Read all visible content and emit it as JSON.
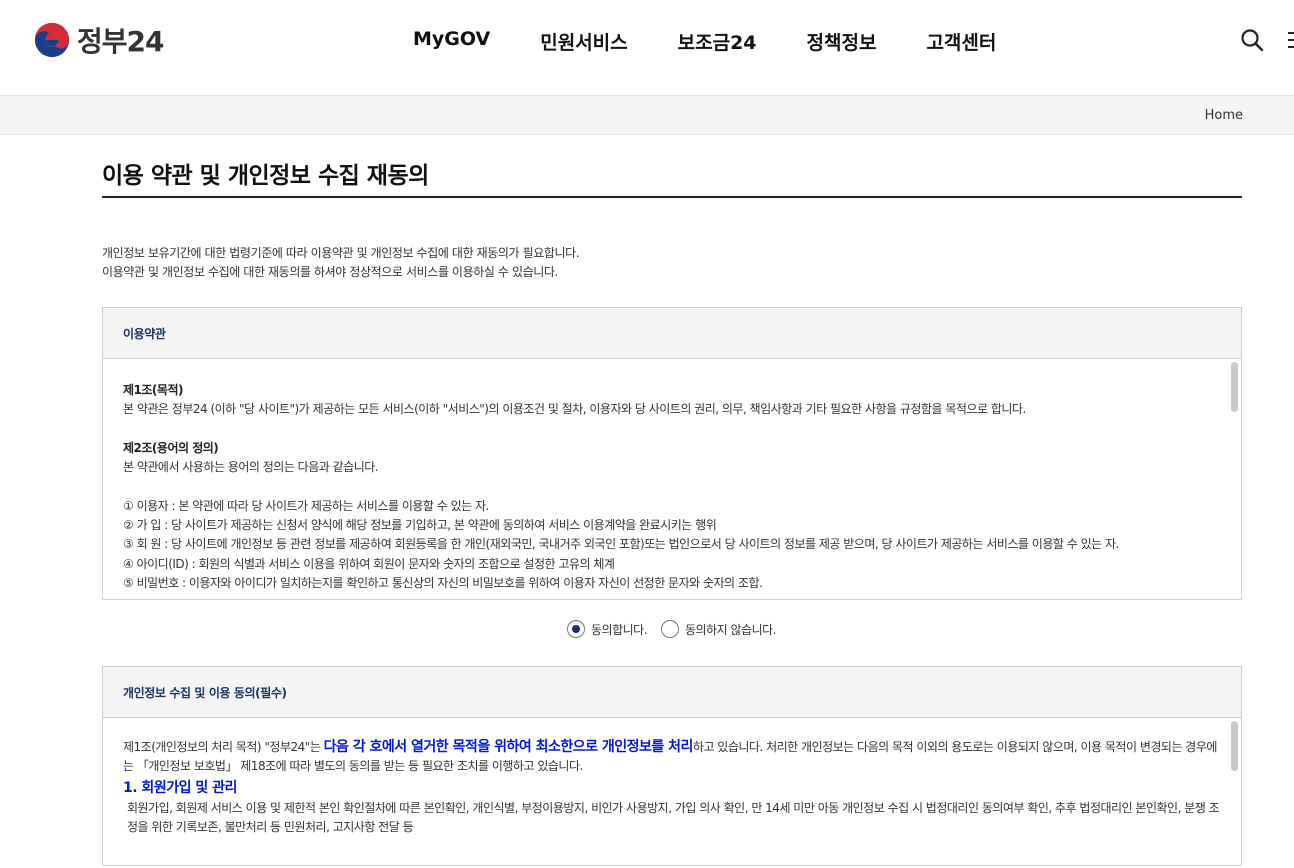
{
  "header": {
    "logo_text": "정부24",
    "nav": [
      "MyGOV",
      "민원서비스",
      "보조금24",
      "정책정보",
      "고객센터"
    ],
    "icons": [
      "search-icon",
      "menu-icon"
    ]
  },
  "breadcrumb": {
    "home": "Home"
  },
  "page": {
    "title": "이용 약관 및 개인정보 수집 재동의",
    "intro": [
      "개인정보 보유기간에 대한 법령기준에 따라 이용약관 및 개인정보 수집에 대한 재동의가 필요합니다.",
      "이용약관 및 개인정보 수집에 대한 재동의를 하셔야 정상적으로 서비스를 이용하실 수 있습니다."
    ]
  },
  "terms": {
    "heading": "이용약관",
    "art1_title": "제1조(목적)",
    "art1_text": "본 약관은 정부24 (이하 \"당 사이트\")가 제공하는 모든 서비스(이하 \"서비스\")의 이용조건 및 절차, 이용자와 당 사이트의 권리, 의무, 책임사항과 기타 필요한 사항을 규정함을 목적으로 합니다.",
    "art2_title": "제2조(용어의 정의)",
    "art2_text": "본 약관에서 사용하는 용어의 정의는 다음과 같습니다.",
    "items": [
      "① 이용자 : 본 약관에 따라 당 사이트가 제공하는 서비스를 이용할 수 있는 자.",
      "② 가 입 : 당 사이트가 제공하는 신청서 양식에 해당 정보를 기입하고, 본 약관에 동의하여 서비스 이용계약을 완료시키는 행위",
      "③ 회 원 : 당 사이트에 개인정보 등 관련 정보를 제공하여 회원등록을 한 개인(재외국민, 국내거주 외국인 포함)또는 법인으로서 당 사이트의 정보를 제공 받으며, 당 사이트가 제공하는 서비스를 이용할 수 있는 자.",
      "④ 아이디(ID) : 회원의 식별과 서비스 이용을 위하여 회원이 문자와 숫자의 조합으로 설정한 고유의 체계",
      "⑤ 비밀번호 : 이용자와 아이디가 일치하는지를 확인하고 통신상의 자신의 비밀보호를 위하여 이용자 자신이 선정한 문자와 숫자의 조합."
    ],
    "agree_label": "동의합니다.",
    "disagree_label": "동의하지 않습니다.",
    "selected": "agree"
  },
  "privacy": {
    "heading": "개인정보 수집 및 이용 동의(필수)",
    "p1_pre": "제1조(개인정보의 처리 목적) \"정부24\"는 ",
    "p1_highlight": "다음 각 호에서 열거한 목적을 위하여 최소한으로 개인정보를 처리",
    "p1_post": "하고 있습니다. 처리한 개인정보는 다음의 목적 이외의 용도로는 이용되지 않으며, 이용 목적이 변경되는 경우에는 「개인정보 보호법」 제18조에 따라 별도의 동의를 받는 등 필요한 조치를 이행하고 있습니다.",
    "sec1_title": "1. 회원가입 및 관리",
    "sec1_text": "회원가입, 회원제 서비스 이용 및 제한적 본인 확인절차에 따른 본인확인, 개인식별, 부정이용방지, 비인가 사용방지, 가입 의사 확인, 만 14세 미만 아동 개인정보 수집 시 법정대리인 동의여부 확인, 추후 법정대리인 본인확인, 분쟁 조정을 위한 기록보존, 불만처리 등 민원처리, 고지사항 전달 등"
  },
  "colors": {
    "accent_blue": "#0019d6",
    "radio_dot": "#1b2a6b",
    "heading_navy": "#1a3560"
  }
}
